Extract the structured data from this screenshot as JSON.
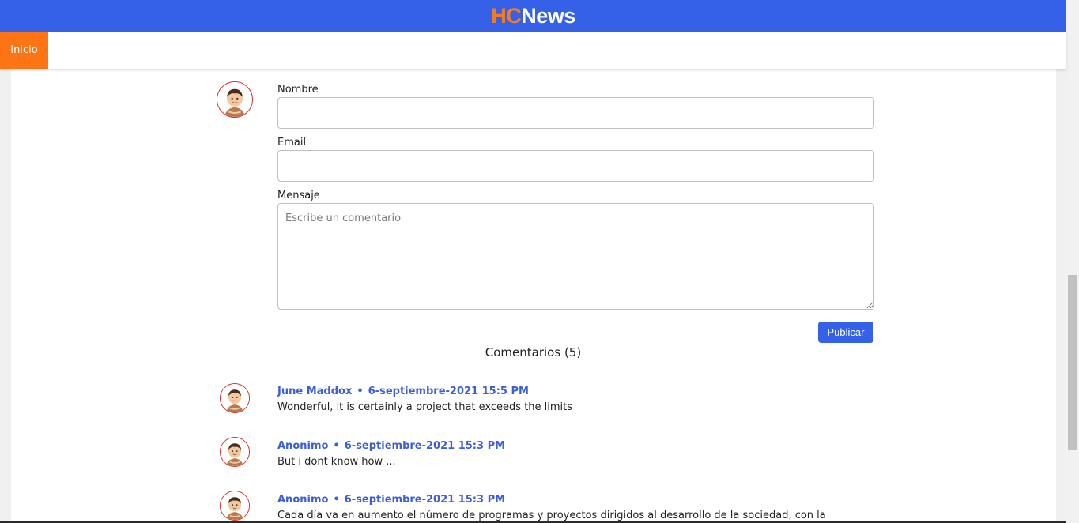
{
  "header": {
    "logo_hc": "HC",
    "logo_news": "News"
  },
  "nav": {
    "items": [
      {
        "label": "Inicio"
      }
    ]
  },
  "form": {
    "name_label": "Nombre",
    "name_value": "",
    "email_label": "Email",
    "email_value": "",
    "message_label": "Mensaje",
    "message_placeholder": "Escribe un comentario",
    "submit_label": "Publicar"
  },
  "comments": {
    "title": "Comentarios (5)",
    "items": [
      {
        "author": "June Maddox",
        "separator": "•",
        "date": "6-septiembre-2021 15:5 PM",
        "text": "Wonderful, it is certainly a project that exceeds the limits"
      },
      {
        "author": "Anonimo",
        "separator": "•",
        "date": "6-septiembre-2021 15:3 PM",
        "text": "But i dont know how ..."
      },
      {
        "author": "Anonimo",
        "separator": "•",
        "date": "6-septiembre-2021 15:3 PM",
        "text": "Cada día va en aumento el número de programas y proyectos dirigidos al desarrollo de la sociedad, con la"
      }
    ]
  },
  "icons": {
    "avatar": "user-avatar-icon"
  },
  "colors": {
    "header_bg": "#3461e8",
    "logo_accent": "#f47b20",
    "nav_active": "#fd7415",
    "link": "#3d5fd6",
    "button": "#3461e8"
  }
}
